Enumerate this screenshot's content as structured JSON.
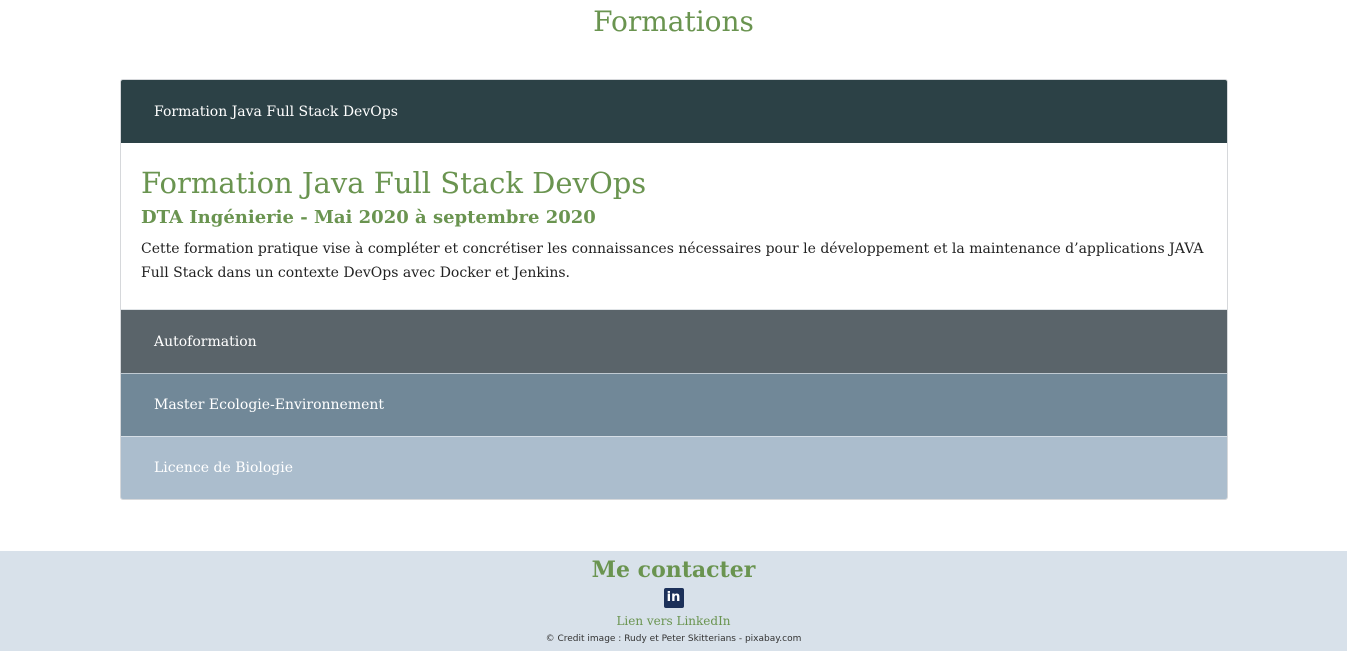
{
  "page": {
    "title": "Formations"
  },
  "accordion": {
    "items": [
      {
        "label": "Formation Java Full Stack DevOps",
        "expanded": true
      },
      {
        "label": "Autoformation",
        "expanded": false
      },
      {
        "label": "Master Ecologie-Environnement",
        "expanded": false
      },
      {
        "label": "Licence de Biologie",
        "expanded": false
      }
    ],
    "panel": {
      "title": "Formation Java Full Stack DevOps",
      "subtitle": "DTA Ingénierie - Mai 2020 à septembre 2020",
      "text": "Cette formation pratique vise à compléter et concrétiser les connaissances nécessaires pour le développement et la maintenance d’applications JAVA Full Stack dans un contexte DevOps avec Docker et Jenkins."
    }
  },
  "footer": {
    "title": "Me contacter",
    "linkedin_icon": "linkedin-icon",
    "linkedin_glyph": "in",
    "link_label": "Lien vers LinkedIn",
    "credit": "© Credit image : Rudy et Peter Skitterians - pixabay.com"
  },
  "colors": {
    "accent_green": "#6a9450",
    "header_dark": "#2c4146",
    "header_gray": "#5a646a",
    "header_slate": "#718898",
    "header_light": "#abbdcd",
    "footer_bg": "#d8e1ea"
  }
}
